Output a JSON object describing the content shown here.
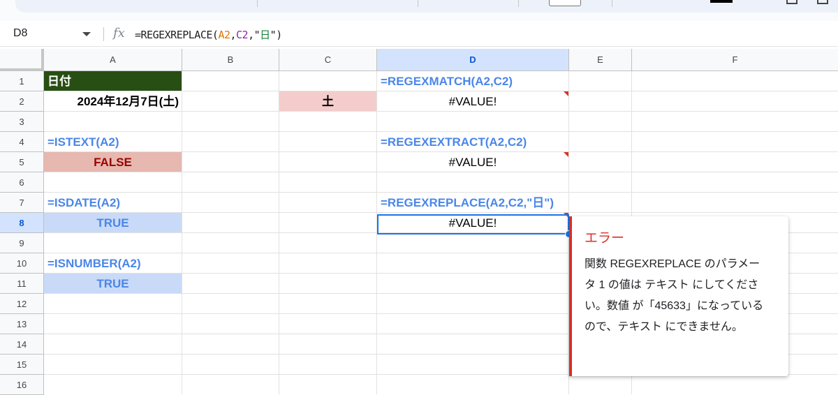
{
  "formula_bar": {
    "name_box": "D8",
    "fx": "fx",
    "formula_parts": [
      {
        "text": "=REGEXREPLACE(",
        "color": "#202124"
      },
      {
        "text": "A2",
        "color": "#e37400"
      },
      {
        "text": ",",
        "color": "#202124"
      },
      {
        "text": "C2",
        "color": "#8e24aa"
      },
      {
        "text": ",\"",
        "color": "#202124"
      },
      {
        "text": "日",
        "color": "#188038"
      },
      {
        "text": "\"",
        "color": "#202124"
      },
      {
        "text": ")",
        "color": "#202124"
      }
    ]
  },
  "columns": [
    "A",
    "B",
    "C",
    "D",
    "E",
    "F"
  ],
  "selected_column": "D",
  "rows": [
    "1",
    "2",
    "3",
    "4",
    "5",
    "6",
    "7",
    "8",
    "9",
    "10",
    "11",
    "12",
    "13",
    "14",
    "15",
    "16"
  ],
  "selected_row": "8",
  "cells": {
    "A1": "日付",
    "A2": "2024年12月7日(土)",
    "C2": "土",
    "D1": "=REGEXMATCH(A2,C2)",
    "D2": "#VALUE!",
    "A4": "=ISTEXT(A2)",
    "A5": "FALSE",
    "D4": "=REGEXEXTRACT(A2,C2)",
    "D5": "#VALUE!",
    "A7": "=ISDATE(A2)",
    "A8": "TRUE",
    "D7": "=REGEXREPLACE(A2,C2,\"日\")",
    "D8": "#VALUE!",
    "A10": "=ISNUMBER(A2)",
    "A11": "TRUE"
  },
  "error_popup": {
    "title": "エラー",
    "body": "関数 REGEXREPLACE のパラメータ 1 の値は テキスト にしてください。数値 が「45633」になっているので、テキスト にできません。"
  },
  "colors": {
    "header_fill": "#274e13",
    "pink_fill": "#f4cccc",
    "false_fill": "#e6b8af",
    "true_fill": "#c9daf8",
    "formula_text": "#4a86e8",
    "error_red": "#d93025",
    "selection_blue": "#1a73e8"
  }
}
